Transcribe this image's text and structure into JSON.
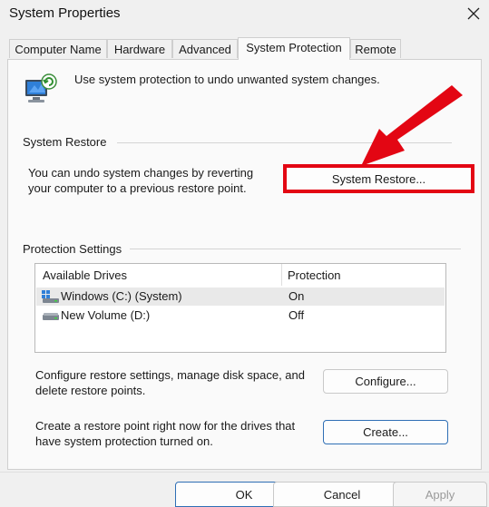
{
  "window": {
    "title": "System Properties"
  },
  "tabs": [
    {
      "label": "Computer Name"
    },
    {
      "label": "Hardware"
    },
    {
      "label": "Advanced"
    },
    {
      "label": "System Protection"
    },
    {
      "label": "Remote"
    }
  ],
  "intro": {
    "text": "Use system protection to undo unwanted system changes."
  },
  "system_restore": {
    "heading": "System Restore",
    "desc_line1": "You can undo system changes by reverting",
    "desc_line2": "your computer to a previous restore point.",
    "button": "System Restore..."
  },
  "protection": {
    "heading": "Protection Settings",
    "columns": {
      "drives": "Available Drives",
      "protection": "Protection"
    },
    "drives": [
      {
        "name": "Windows (C:) (System)",
        "protection": "On"
      },
      {
        "name": "New Volume (D:)",
        "protection": "Off"
      }
    ],
    "configure_line1": "Configure restore settings, manage disk space, and",
    "configure_line2": "delete restore points.",
    "configure_button": "Configure...",
    "create_line1": "Create a restore point right now for the drives that",
    "create_line2": "have system protection turned on.",
    "create_button": "Create..."
  },
  "footer": {
    "ok": "OK",
    "cancel": "Cancel",
    "apply": "Apply"
  },
  "colors": {
    "annotation": "#e30613",
    "accent": "#2f6fb5"
  }
}
